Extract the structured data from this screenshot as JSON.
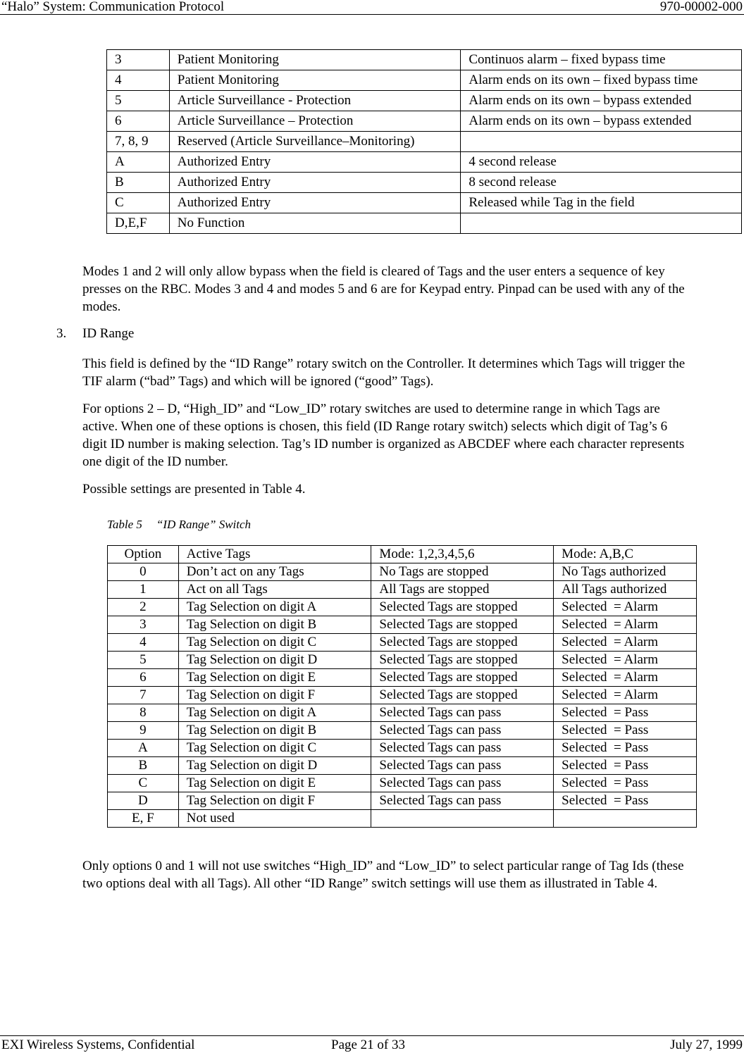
{
  "header": {
    "title": "“Halo” System: Communication Protocol",
    "doc_number": "970-00002-000"
  },
  "mode_table": {
    "rows": [
      [
        "3",
        "Patient Monitoring",
        "Continuos alarm – fixed bypass time"
      ],
      [
        "4",
        "Patient Monitoring",
        "Alarm ends on its own – fixed bypass time"
      ],
      [
        "5",
        "Article Surveillance - Protection",
        "Alarm ends on its own – bypass extended"
      ],
      [
        "6",
        "Article Surveillance – Protection",
        "Alarm ends on its own – bypass extended"
      ],
      [
        "7, 8, 9",
        "Reserved (Article Surveillance–Monitoring)",
        ""
      ],
      [
        "A",
        "Authorized Entry",
        "4 second release"
      ],
      [
        "B",
        "Authorized Entry",
        "8 second release"
      ],
      [
        "C",
        "Authorized Entry",
        "Released while Tag in the field"
      ],
      [
        "D,E,F",
        "No Function",
        ""
      ]
    ]
  },
  "paragraphs": {
    "modes_note": "Modes 1 and 2 will only allow bypass when the field is cleared of Tags and the user enters a sequence of key presses on the RBC. Modes 3 and 4 and modes 5 and 6 are for Keypad entry. Pinpad can be used with any of the modes.",
    "section_number": "3.",
    "section_title": "ID Range",
    "id_range_intro": "This field is defined by the “ID Range” rotary switch on the Controller. It determines which Tags will trigger the TIF alarm (“bad” Tags) and which will be ignored (“good” Tags).",
    "id_range_options": "For options 2 – D, “High_ID” and “Low_ID” rotary switches are used to determine range in which Tags are active. When one of these options is chosen, this field (ID Range rotary switch) selects which digit of Tag’s 6 digit ID number is making selection. Tag’s ID number is organized as ABCDEF where each character represents one digit of the ID number.",
    "possible_settings": "Possible settings are presented in Table 4.",
    "closing_note": "Only options 0 and 1 will not use switches “High_ID” and “Low_ID” to select particular range of Tag Ids (these two options deal with all Tags). All other “ID Range” switch settings will use them as illustrated in Table 4."
  },
  "id_range_table": {
    "caption_label": "Table 5",
    "caption_title": "“ID Range” Switch",
    "headers": [
      "Option",
      "Active Tags",
      "Mode: 1,2,3,4,5,6",
      "Mode: A,B,C"
    ],
    "rows": [
      [
        "0",
        "Don’t act on any Tags",
        "No Tags are stopped",
        "No Tags authorized"
      ],
      [
        "1",
        "Act on all Tags",
        "All Tags are stopped",
        "All Tags authorized"
      ],
      [
        "2",
        "Tag Selection on digit A",
        "Selected Tags are stopped",
        "Selected  = Alarm"
      ],
      [
        "3",
        "Tag Selection on digit B",
        "Selected Tags are stopped",
        "Selected  = Alarm"
      ],
      [
        "4",
        "Tag Selection on digit C",
        "Selected Tags are stopped",
        "Selected  = Alarm"
      ],
      [
        "5",
        "Tag Selection on digit D",
        "Selected Tags are stopped",
        "Selected  = Alarm"
      ],
      [
        "6",
        "Tag Selection on digit E",
        "Selected Tags are stopped",
        "Selected  = Alarm"
      ],
      [
        "7",
        "Tag Selection on digit F",
        "Selected Tags are stopped",
        "Selected  = Alarm"
      ],
      [
        "8",
        "Tag Selection on digit A",
        "Selected Tags can pass",
        "Selected  = Pass"
      ],
      [
        "9",
        "Tag Selection on digit B",
        "Selected Tags can pass",
        "Selected  = Pass"
      ],
      [
        "A",
        "Tag Selection on digit C",
        "Selected Tags can pass",
        "Selected  = Pass"
      ],
      [
        "B",
        "Tag Selection on digit D",
        "Selected Tags can pass",
        "Selected  = Pass"
      ],
      [
        "C",
        "Tag Selection on digit E",
        "Selected Tags can pass",
        "Selected  = Pass"
      ],
      [
        "D",
        "Tag Selection on digit F",
        "Selected Tags can pass",
        "Selected  = Pass"
      ],
      [
        "E, F",
        "Not used",
        "",
        ""
      ]
    ]
  },
  "footer": {
    "company": "EXI Wireless Systems, Confidential",
    "page": "Page 21 of 33",
    "date": "July 27, 1999"
  }
}
